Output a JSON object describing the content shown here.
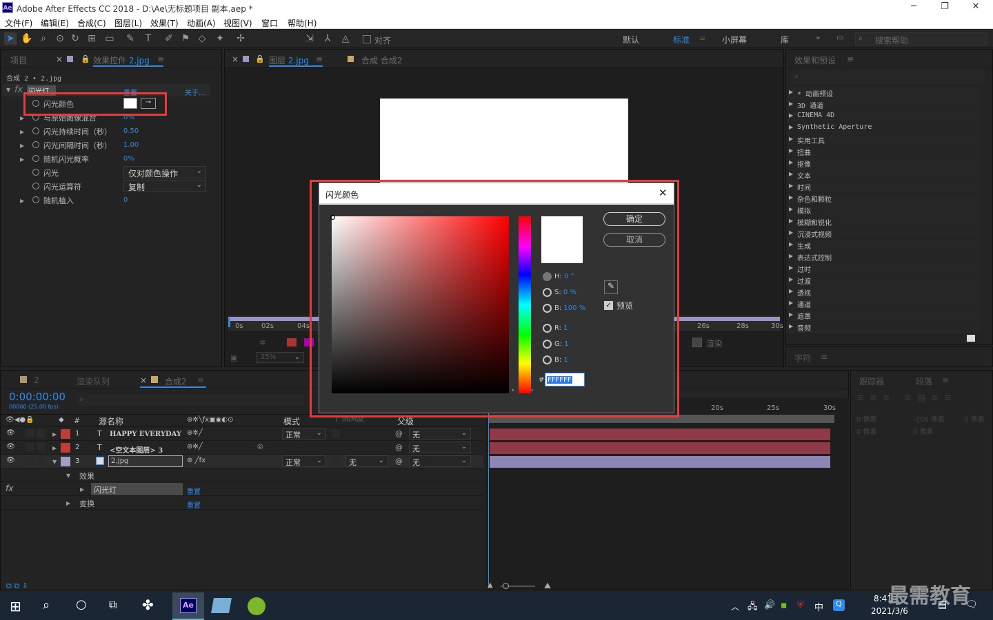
{
  "window": {
    "title": "Adobe After Effects CC 2018 - D:\\Ae\\无标题项目 副本.aep *",
    "app_icon": "Ae"
  },
  "menu": [
    "文件(F)",
    "编辑(E)",
    "合成(C)",
    "图层(L)",
    "效果(T)",
    "动画(A)",
    "视图(V)",
    "窗口",
    "帮助(H)"
  ],
  "toolbar": {
    "snap_label": "对齐",
    "workspaces": [
      "默认",
      "标准",
      "小屏幕",
      "库"
    ],
    "active_workspace": "标准",
    "search_placeholder": "搜索帮助"
  },
  "left_panel": {
    "tab_project": "项目",
    "tab_effects": "效果控件",
    "tab_effects_target": "2.jpg",
    "breadcrumb": "合成 2 • 2.jpg",
    "effect": {
      "fx": "fx",
      "name": "闪光灯",
      "reset": "重置",
      "about": "关于..."
    },
    "props": [
      {
        "label": "闪光颜色",
        "value": ""
      },
      {
        "label": "与原始图像混合",
        "value": "0%"
      },
      {
        "label": "闪光持续时间（秒）",
        "value": "0.50"
      },
      {
        "label": "闪光间隔时间（秒）",
        "value": "1.00"
      },
      {
        "label": "随机闪光概率",
        "value": "0%"
      },
      {
        "label": "闪光",
        "value": "仅对颜色操作"
      },
      {
        "label": "闪光运算符",
        "value": "复制"
      },
      {
        "label": "随机植入",
        "value": "0"
      }
    ]
  },
  "center_panel": {
    "tab_layer": "图层",
    "tab_layer_target": "2.jpg",
    "tab_comp": "合成 合成2",
    "ruler": [
      "0s",
      "02s",
      "04s",
      "26s",
      "28s",
      "30s"
    ],
    "zoom": "25%",
    "render_label": "渲染"
  },
  "right_panel": {
    "tab": "效果和预设",
    "items": [
      "* 动画预设",
      "3D 通道",
      "CINEMA 4D",
      "Synthetic Aperture",
      "实用工具",
      "扭曲",
      "抠像",
      "文本",
      "时间",
      "杂色和颗粒",
      "模拟",
      "模糊和锐化",
      "沉浸式视频",
      "生成",
      "表达式控制",
      "过时",
      "过渡",
      "透视",
      "通道",
      "遮罩",
      "音频"
    ],
    "tab_char": "字符",
    "tab_tracker": "跟踪器",
    "tab_paragraph": "段落",
    "para_values": [
      "0 像素",
      "-206 像素",
      "0 像素",
      "0 像素",
      "0 像素"
    ]
  },
  "timeline": {
    "tab_render": "渲染队列",
    "tab_comp": "合成2",
    "timecode": "0:00:00:00",
    "fps": "00000 (25.00 fps)",
    "headers": {
      "source": "源名称",
      "mode": "模式",
      "trkmat": "T  TrkMat",
      "parent": "父级"
    },
    "ruler": [
      "20s",
      "25s",
      "30s"
    ],
    "layers": [
      {
        "num": "1",
        "type": "T",
        "name": "HAPPY EVERYDAY",
        "mode": "正常",
        "parent": "无",
        "color": "#c23b3b",
        "bar": "#8f3a46"
      },
      {
        "num": "2",
        "type": "T",
        "name": "<空文本图层> 3",
        "mode": "",
        "parent": "无",
        "color": "#c23b3b",
        "bar": "#8f3a46"
      },
      {
        "num": "3",
        "type": "",
        "name": "2.jpg",
        "mode": "正常",
        "trkmat": "无",
        "parent": "无",
        "color": "#a39ec8",
        "bar": "#8b86b3"
      }
    ],
    "sub": {
      "effects": "效果",
      "effect_name": "闪光灯",
      "reset": "重置",
      "transform": "变换",
      "transform_reset": "重置"
    }
  },
  "dialog": {
    "title": "闪光颜色",
    "ok": "确定",
    "cancel": "取消",
    "H": "0 °",
    "S": "0 %",
    "B": "100 %",
    "R": "1",
    "G": "1",
    "B2": "1",
    "hex": "FFFFFF",
    "preview": "预览"
  },
  "taskbar": {
    "time": "8:41",
    "date": "2021/3/6",
    "ime": "中",
    "watermark": "最需教育"
  }
}
